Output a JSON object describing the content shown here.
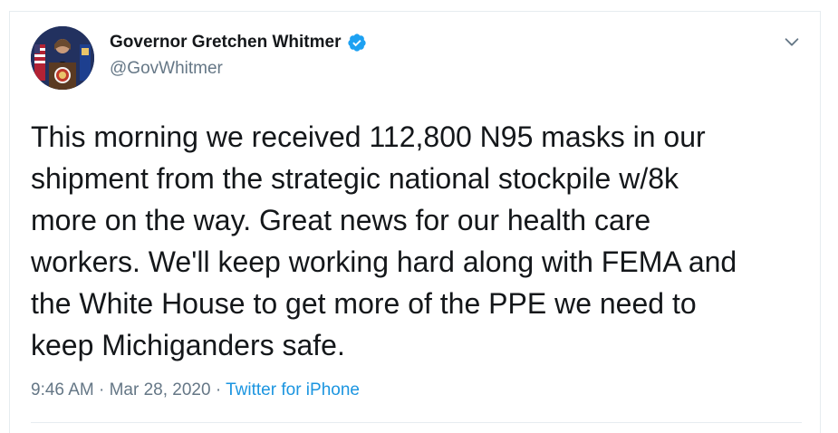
{
  "tweet": {
    "author": {
      "display_name": "Governor Gretchen Whitmer",
      "handle": "@GovWhitmer",
      "verified": true
    },
    "text": "This morning we received 112,800 N95 masks in our\nshipment from the strategic national stockpile w/8k\nmore on the way. Great news for our health care\nworkers. We'll keep working hard along with FEMA and\nthe White House to get more of the PPE we need to\nkeep Michiganders safe.",
    "time": "9:46 AM",
    "separator": "·",
    "date": "Mar 28, 2020",
    "source": "Twitter for iPhone"
  },
  "icons": {
    "verified": "verified-badge-icon",
    "menu": "chevron-down-icon"
  },
  "colors": {
    "text": "#14171a",
    "secondary": "#657786",
    "link": "#1b95e0",
    "border": "#e6ecf0",
    "verified": "#1da1f2"
  }
}
